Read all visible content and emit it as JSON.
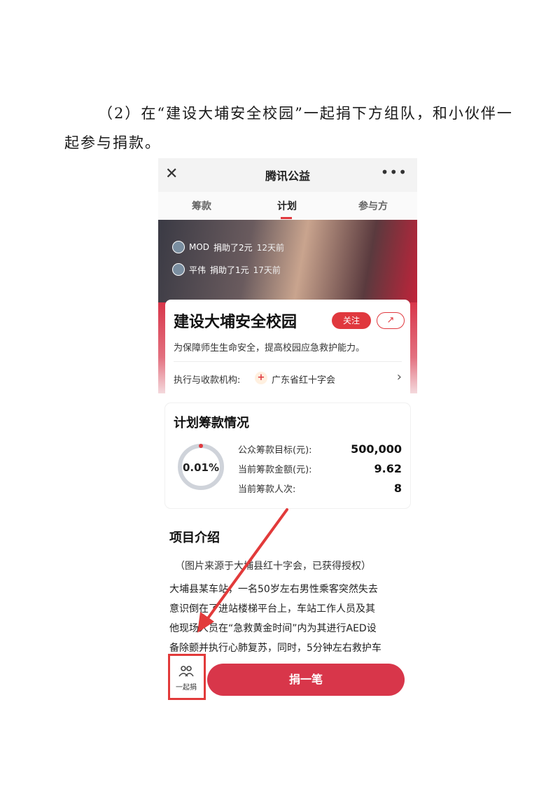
{
  "document": {
    "line1": "（2）在“建设大埔安全校园”一起捐下方组队，和小伙伴一",
    "line2": "起参与捐款。"
  },
  "nav": {
    "title": "腾讯公益",
    "close_glyph": "✕",
    "more_glyph": "•••"
  },
  "tabs": [
    "筹款",
    "计划",
    "参与方"
  ],
  "donors": [
    {
      "name": "MOD",
      "text": "捐助了2元",
      "time": "12天前"
    },
    {
      "name": "平伟",
      "text": "捐助了1元",
      "time": "17天前"
    }
  ],
  "project": {
    "title": "建设大埔安全校园",
    "follow_label": "关注",
    "share_glyph": "↗",
    "description": "为保障师生生命安全，提高校园应急救护能力。",
    "org_label": "执行与收款机构:",
    "org_name": "广东省红十字会",
    "org_icon": "+",
    "arrow_glyph": "›"
  },
  "funding": {
    "title": "计划筹款情况",
    "progress_label": "0.01%",
    "progress_fraction": 0.0001,
    "stats": [
      {
        "label": "公众筹款目标(元):",
        "value": "500,000"
      },
      {
        "label": "当前筹款金额(元):",
        "value": "9.62"
      },
      {
        "label": "当前筹款人次:",
        "value": "8"
      }
    ]
  },
  "intro": {
    "title": "项目介绍",
    "caption": "（图片来源于大埔县红十字会，已获得授权）",
    "lines": [
      "大埔县某车站，一名50岁左右男性乘客突然失去",
      "意识倒在了进站楼梯平台上，车站工作人员及其",
      "他现场人员在“急救黄金时间”内为其进行AED设",
      "备除颤并执行心肺复苏，同时，5分钟左右救护车"
    ]
  },
  "bottom": {
    "together_icon": "people-icon",
    "together_label": "一起捐",
    "donate_label": "捐一笔"
  },
  "colors": {
    "accent": "#d8364a",
    "annotation": "#e23a3a"
  }
}
